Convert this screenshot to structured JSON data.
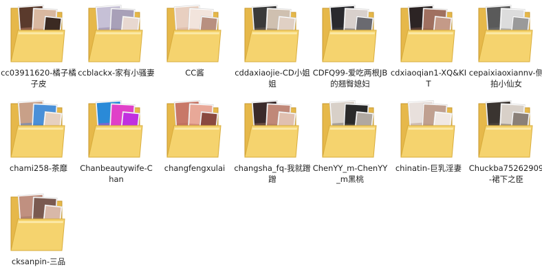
{
  "folders": [
    {
      "label": "cc03911620-橘子橘子皮",
      "thumbs": [
        "#5a3a2c",
        "#d9b8a0",
        "#3b2a22"
      ],
      "accent": "#c98a6a"
    },
    {
      "label": "ccblackx-家有小骚妻",
      "thumbs": [
        "#c6c0d6",
        "#a8a0b8",
        "#e8d8d0"
      ],
      "accent": "#8a7a9a"
    },
    {
      "label": "CC酱",
      "thumbs": [
        "#e8cfc0",
        "#f2e4dc",
        "#b89080"
      ],
      "accent": "#d8a890"
    },
    {
      "label": "cddaxiaojie-CD小姐姐",
      "thumbs": [
        "#3a3a3a",
        "#cfc0b0",
        "#e0d0c4"
      ],
      "accent": "#7a6a60"
    },
    {
      "label": "CDFQ99-爱吃两根JB的翘臀媳妇",
      "thumbs": [
        "#2a2a2e",
        "#d8d0cc",
        "#6a6a70"
      ],
      "accent": "#4a4a50"
    },
    {
      "label": "cdxiaoqian1-XQ&KIT",
      "thumbs": [
        "#2c2424",
        "#a07060",
        "#c49a88"
      ],
      "accent": "#8a5a48"
    },
    {
      "label": "cepaixiaoxiannv-侧拍小仙女",
      "thumbs": [
        "#5a5a5a",
        "#dcdcdc",
        "#9a9a9a"
      ],
      "accent": "#787878"
    },
    {
      "label": "chami258-茶靡",
      "thumbs": [
        "#c8a088",
        "#4a90d8",
        "#e6d0c0"
      ],
      "accent": "#3a7ad0"
    },
    {
      "label": "Chanbeautywife-Chan",
      "thumbs": [
        "#2a8ad8",
        "#e040c8",
        "#c030e0"
      ],
      "accent": "#d040d0"
    },
    {
      "label": "changfengxulai",
      "thumbs": [
        "#c87868",
        "#e8a898",
        "#8a4a40"
      ],
      "accent": "#b86858"
    },
    {
      "label": "changsha_fq-我就蹭蹭",
      "thumbs": [
        "#3a2a2a",
        "#c08878",
        "#e0c0b0"
      ],
      "accent": "#a07060"
    },
    {
      "label": "ChenYY_m-ChenYY_m黑桃",
      "thumbs": [
        "#d8d0c8",
        "#2a2a2a",
        "#b0a8a0"
      ],
      "accent": "#6a6460"
    },
    {
      "label": "chinatin-巨乳淫妻",
      "thumbs": [
        "#e8e0dc",
        "#c0a090",
        "#f0e8e4"
      ],
      "accent": "#b09080"
    },
    {
      "label": "Chuckba75262909-裙下之臣",
      "thumbs": [
        "#3a3430",
        "#d8d0c8",
        "#8a8078"
      ],
      "accent": "#5a5048"
    },
    {
      "label": "cksanpin-三品",
      "thumbs": [
        "#c09080",
        "#7a5a50",
        "#d8b8a8"
      ],
      "accent": "#9a7060"
    }
  ]
}
